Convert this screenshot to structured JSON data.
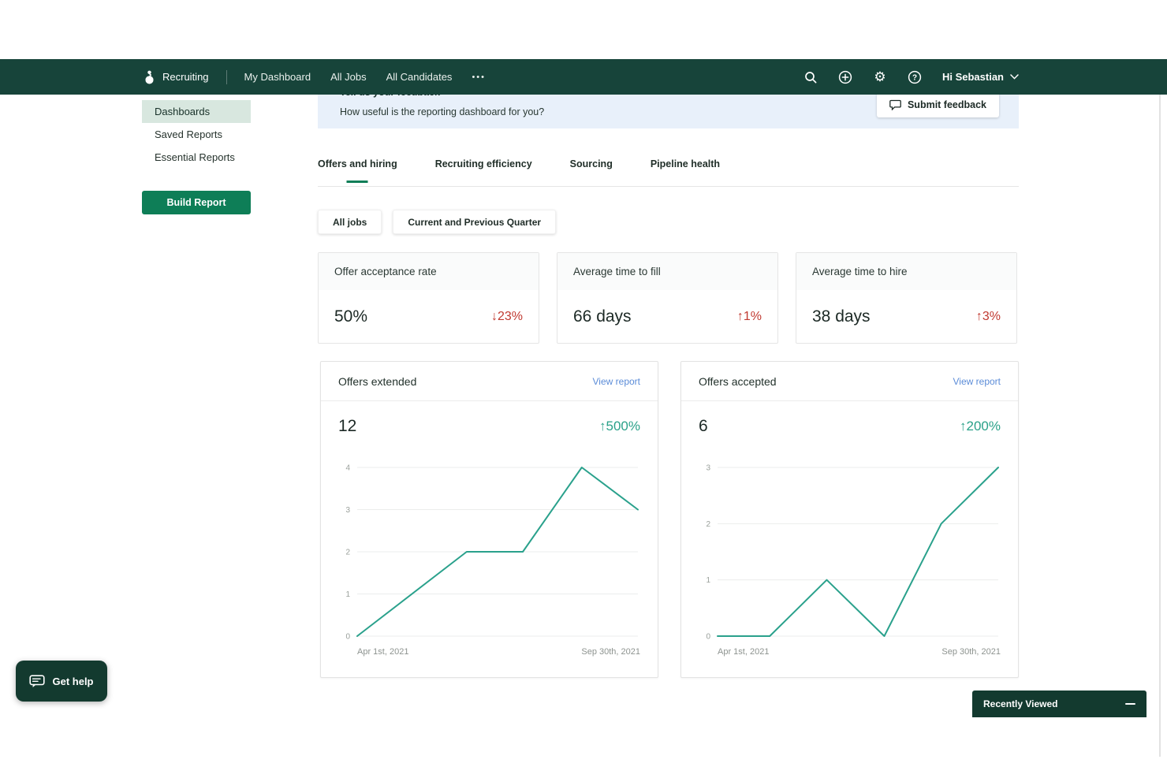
{
  "nav": {
    "brand": "Recruiting",
    "items": [
      {
        "label": "My Dashboard"
      },
      {
        "label": "All Jobs"
      },
      {
        "label": "All Candidates"
      },
      {
        "label": "•••"
      }
    ],
    "icons": [
      "greenhouse-logo",
      "search-icon",
      "add-icon",
      "settings-icon",
      "help-icon",
      "chevron-down-icon"
    ],
    "user": "Hi Sebastian"
  },
  "sidebar": {
    "items": [
      {
        "label": "Dashboards",
        "active": true
      },
      {
        "label": "Saved Reports",
        "active": false
      },
      {
        "label": "Essential Reports",
        "active": false
      }
    ],
    "build_report_label": "Build Report"
  },
  "feedback": {
    "title": "Tell us your feedback",
    "question": "How useful is the reporting dashboard for you?",
    "submit_label": "Submit feedback",
    "submit_icon": "feedback-bubble-icon"
  },
  "tabs": [
    {
      "label": "Offers and hiring",
      "active": true
    },
    {
      "label": "Recruiting efficiency",
      "active": false
    },
    {
      "label": "Sourcing",
      "active": false
    },
    {
      "label": "Pipeline health",
      "active": false
    }
  ],
  "filters": {
    "jobs": "All jobs",
    "period": "Current and Previous Quarter"
  },
  "metrics": [
    {
      "title": "Offer acceptance rate",
      "value": "50%",
      "delta": "↓23%",
      "delta_color": "#c13a31"
    },
    {
      "title": "Average time to fill",
      "value": "66 days",
      "delta": "↑1%",
      "delta_color": "#c13a31"
    },
    {
      "title": "Average time to hire",
      "value": "38 days",
      "delta": "↑3%",
      "delta_color": "#c13a31"
    }
  ],
  "chart_data": [
    {
      "type": "line",
      "title": "Offers extended",
      "link": "View report",
      "current_value": "12",
      "delta": "↑500%",
      "x_start_label": "Apr 1st, 2021",
      "x_end_label": "Sep 30th, 2021",
      "ylim": [
        0,
        4
      ],
      "yticks": [
        0,
        1,
        2,
        3,
        4
      ],
      "x": [
        0,
        0.39,
        0.59,
        0.8,
        1
      ],
      "values": [
        0,
        2,
        2,
        4,
        3
      ],
      "line_color": "#2aa18c",
      "grid": true,
      "legend": false
    },
    {
      "type": "line",
      "title": "Offers accepted",
      "link": "View report",
      "current_value": "6",
      "delta": "↑200%",
      "x_start_label": "Apr 1st, 2021",
      "x_end_label": "Sep 30th, 2021",
      "ylim": [
        0,
        3
      ],
      "yticks": [
        0,
        1,
        2,
        3
      ],
      "x": [
        0,
        0.186,
        0.389,
        0.594,
        0.797,
        1
      ],
      "values": [
        0,
        0,
        1,
        0,
        2,
        3
      ],
      "line_color": "#2aa18c",
      "grid": true,
      "legend": false
    }
  ],
  "help_button": "Get help",
  "recently_viewed": "Recently Viewed",
  "colors": {
    "nav_bg": "#17443a",
    "primary_green": "#0e7e57",
    "sidebar_active_bg": "#d8e7df",
    "banner_bg": "#e8f0fa",
    "negative_red": "#c13a31",
    "positive_teal": "#2aa18c",
    "link_blue": "#5b8cd8",
    "dark_pill": "#133a2f"
  }
}
